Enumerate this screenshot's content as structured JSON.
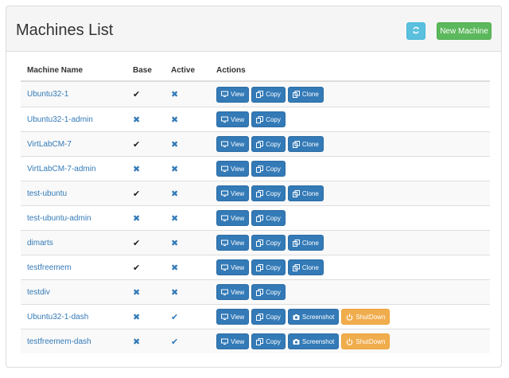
{
  "header": {
    "title": "Machines List",
    "refresh_icon": "refresh-icon",
    "new_machine_label": "New Machine"
  },
  "table": {
    "columns": [
      "Machine Name",
      "Base",
      "Active",
      "Actions"
    ],
    "rows": [
      {
        "name": "Ubuntu32-1",
        "base": true,
        "active": false,
        "actions": [
          "View",
          "Copy",
          "Clone"
        ]
      },
      {
        "name": "Ubuntu32-1-admin",
        "base": false,
        "active": false,
        "actions": [
          "View",
          "Copy"
        ]
      },
      {
        "name": "VirtLabCM-7",
        "base": true,
        "active": false,
        "actions": [
          "View",
          "Copy",
          "Clone"
        ]
      },
      {
        "name": "VirtLabCM-7-admin",
        "base": false,
        "active": false,
        "actions": [
          "View",
          "Copy"
        ]
      },
      {
        "name": "test-ubuntu",
        "base": true,
        "active": false,
        "actions": [
          "View",
          "Copy",
          "Clone"
        ]
      },
      {
        "name": "test-ubuntu-admin",
        "base": false,
        "active": false,
        "actions": [
          "View",
          "Copy"
        ]
      },
      {
        "name": "dimarts",
        "base": true,
        "active": false,
        "actions": [
          "View",
          "Copy",
          "Clone"
        ]
      },
      {
        "name": "testfreemem",
        "base": true,
        "active": false,
        "actions": [
          "View",
          "Copy",
          "Clone"
        ]
      },
      {
        "name": "testdiv",
        "base": false,
        "active": false,
        "actions": [
          "View",
          "Copy"
        ]
      },
      {
        "name": "Ubuntu32-1-dash",
        "base": false,
        "active": true,
        "actions": [
          "View",
          "Copy",
          "Screenshot",
          "ShutDown"
        ]
      },
      {
        "name": "testfreemem-dash",
        "base": false,
        "active": true,
        "actions": [
          "View",
          "Copy",
          "Screenshot",
          "ShutDown"
        ]
      }
    ]
  },
  "icons": {
    "View": "monitor-icon",
    "Copy": "copy-icon",
    "Clone": "clone-icon",
    "Screenshot": "camera-icon",
    "ShutDown": "power-icon",
    "true": "check-icon",
    "false": "cross-icon"
  },
  "colors": {
    "primary": "#337ab7",
    "success": "#5cb85c",
    "info": "#5bc0de",
    "warning": "#f0ad4e"
  }
}
